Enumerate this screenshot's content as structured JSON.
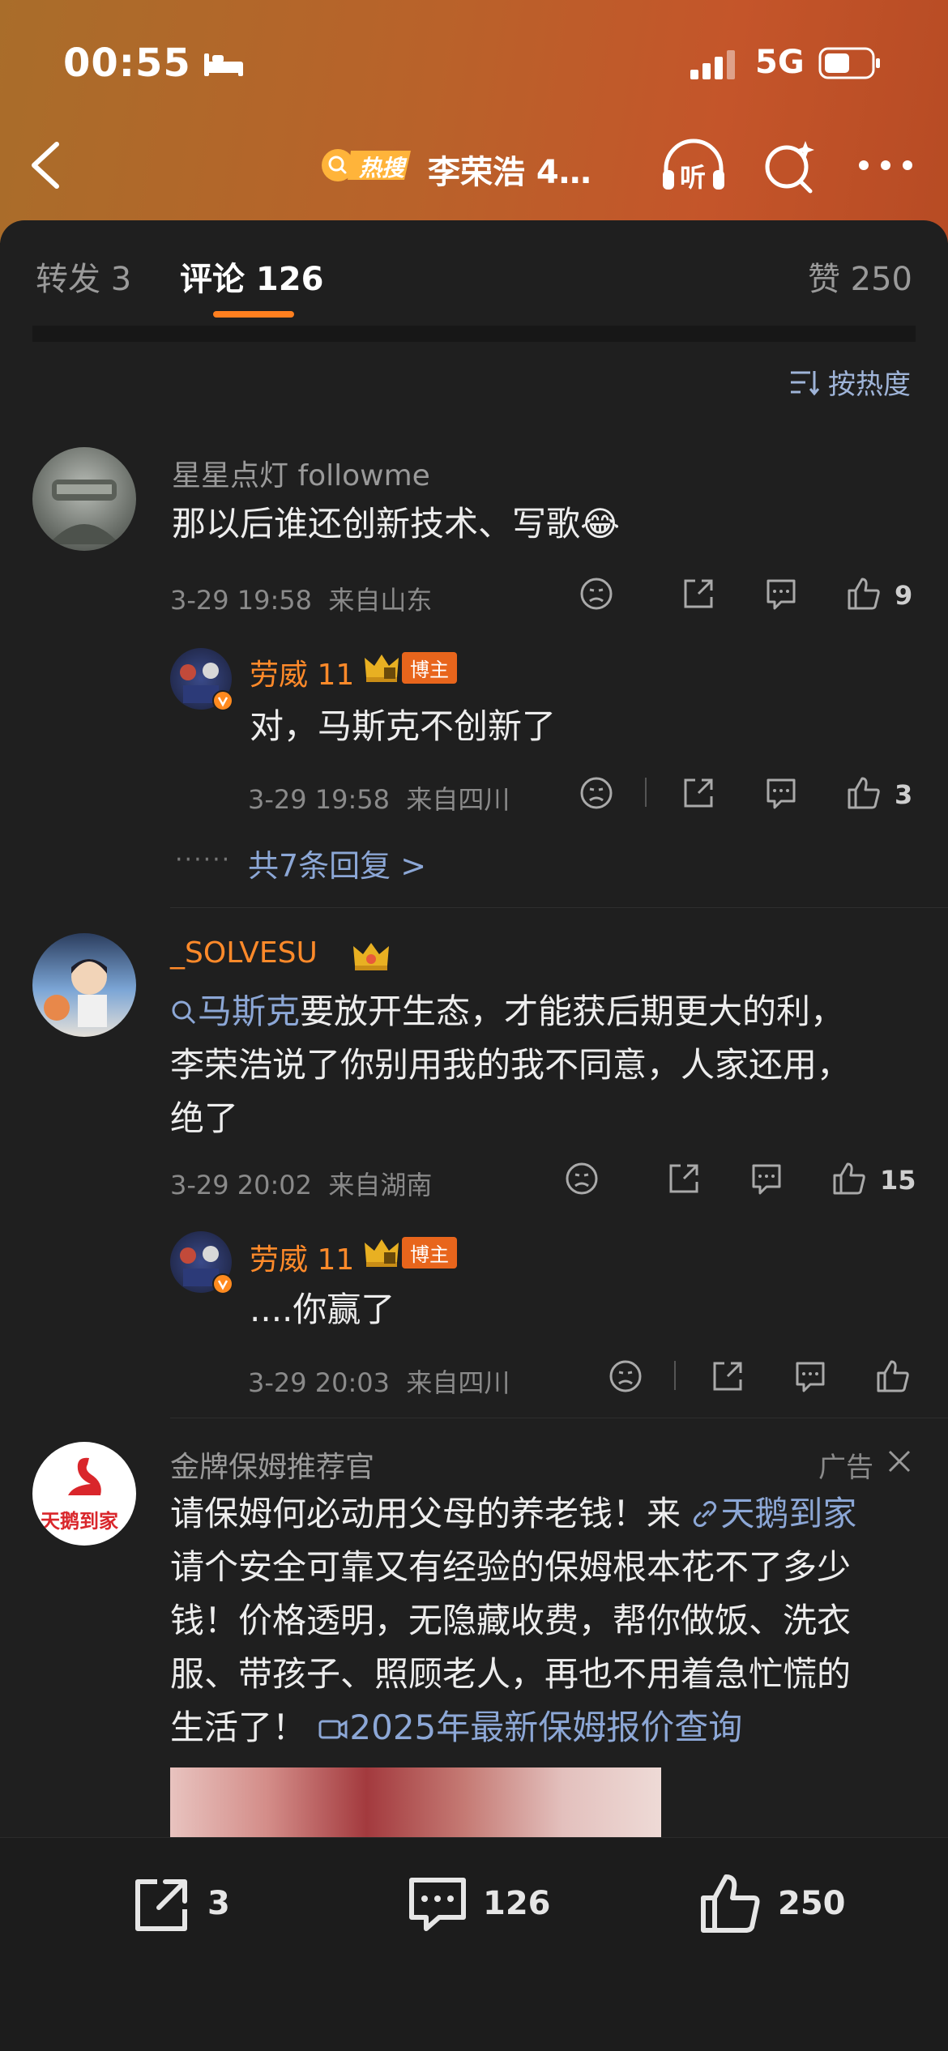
{
  "status_bar": {
    "time": "00:55",
    "network": "5G"
  },
  "nav": {
    "hot_badge": "热搜",
    "title": "李荣浩 4…",
    "listen_label": "听"
  },
  "tabs": {
    "repost": "转发 3",
    "comments": "评论 126",
    "likes": "赞 250"
  },
  "sort_label": "按热度",
  "comments": [
    {
      "user": "星星点灯 followme",
      "text": "那以后谁还创新技术、写歌",
      "emoji": "😂",
      "time": "3-29 19:58",
      "location": "来自山东",
      "likes": "9",
      "reply": {
        "user": "劳威 11",
        "badge": "博主",
        "text": "对，马斯克不创新了",
        "time": "3-29 19:58",
        "location": "来自四川",
        "likes": "3"
      },
      "more_replies": "共7条回复 >"
    },
    {
      "user": "_SOLVESU",
      "topic": "马斯克",
      "text_line1": "要放开生态，才能获后期更大的利，",
      "text_line2": "李荣浩说了你别用我的我不同意，人家还用，",
      "text_line3": "绝了",
      "time": "3-29 20:02",
      "location": "来自湖南",
      "likes": "15",
      "reply": {
        "user": "劳威 11",
        "badge": "博主",
        "text": "....你赢了",
        "time": "3-29 20:03",
        "location": "来自四川"
      }
    }
  ],
  "ad": {
    "user": "金牌保姆推荐官",
    "ad_label": "广告",
    "logo_text": "天鹅到家",
    "line1": "请保姆何必动用父母的养老钱！来",
    "link": "天鹅到家",
    "line2": "请个安全可靠又有经验的保姆根本花不了多少",
    "line3": "钱！价格透明，无隐藏收费，帮你做饭、洗衣",
    "line4": "服、带孩子、照顾老人，再也不用着急忙慌的",
    "line5": "生活了！",
    "video_link": "2025年最新保姆报价查询"
  },
  "bottom_bar": {
    "repost": "3",
    "comments": "126",
    "likes": "250"
  },
  "colors": {
    "accent": "#ff7f1f",
    "link": "#8ca7d6",
    "background": "#1f1f1f"
  }
}
